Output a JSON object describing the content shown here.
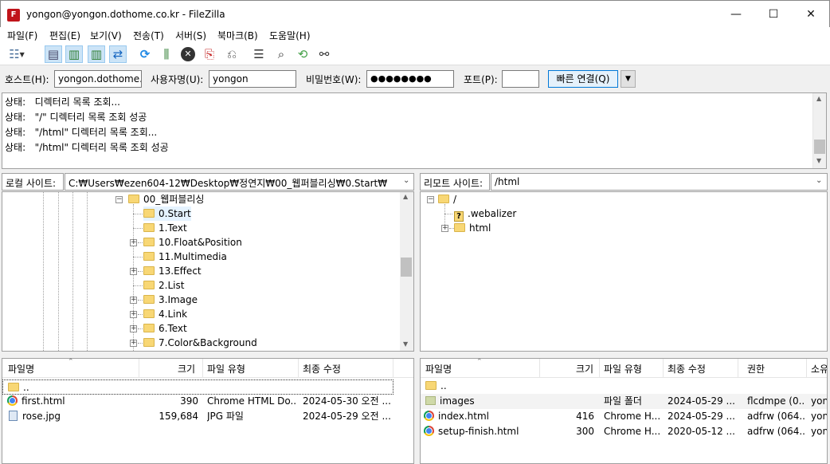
{
  "window": {
    "title": "yongon@yongon.dothome.co.kr - FileZilla",
    "app_icon_letter": "F"
  },
  "menu": [
    "파일(F)",
    "편집(E)",
    "보기(V)",
    "전송(T)",
    "서버(S)",
    "북마크(B)",
    "도움말(H)"
  ],
  "quickconnect": {
    "host_label": "호스트(H):",
    "host_value": "yongon.dothome.c",
    "user_label": "사용자명(U):",
    "user_value": "yongon",
    "pass_label": "비밀번호(W):",
    "pass_value": "●●●●●●●●",
    "port_label": "포트(P):",
    "port_value": "",
    "connect_label": "빠른 연결(Q)"
  },
  "log": [
    {
      "status": "상태:",
      "message": "디렉터리 목록 조회..."
    },
    {
      "status": "상태:",
      "message": "\"/\" 디렉터리 목록 조회 성공"
    },
    {
      "status": "상태:",
      "message": "\"/html\" 디렉터리 목록 조회..."
    },
    {
      "status": "상태:",
      "message": "\"/html\" 디렉터리 목록 조회 성공"
    }
  ],
  "local": {
    "site_label": "로컬 사이트:",
    "path": "C:₩Users₩ezen604-12₩Desktop₩정연지₩00_웹퍼블리싱₩0.Start₩",
    "tree": [
      "00_웹퍼블리싱",
      "0.Start",
      "1.Text",
      "10.Float&Position",
      "11.Multimedia",
      "13.Effect",
      "2.List",
      "3.Image",
      "4.Link",
      "6.Text",
      "7.Color&Background"
    ],
    "columns": [
      "파일명",
      "크기",
      "파일 유형",
      "최종 수정"
    ],
    "files": [
      {
        "name": "..",
        "size": "",
        "type": "",
        "modified": "",
        "icon": "folder-icon"
      },
      {
        "name": "first.html",
        "size": "390",
        "type": "Chrome HTML Do...",
        "modified": "2024-05-30 오전 ...",
        "icon": "chrome-icon"
      },
      {
        "name": "rose.jpg",
        "size": "159,684",
        "type": "JPG 파일",
        "modified": "2024-05-29 오전 ...",
        "icon": "image-file-icon"
      }
    ]
  },
  "remote": {
    "site_label": "리모트 사이트:",
    "path": "/html",
    "tree": [
      "/",
      ".webalizer",
      "html"
    ],
    "columns": [
      "파일명",
      "크기",
      "파일 유형",
      "최종 수정",
      "권한",
      "소유"
    ],
    "files": [
      {
        "name": "..",
        "size": "",
        "type": "",
        "modified": "",
        "perm": "",
        "owner": "",
        "icon": "folder-icon"
      },
      {
        "name": "images",
        "size": "",
        "type": "파일 폴더",
        "modified": "2024-05-29 ...",
        "perm": "flcdmpe (0...",
        "owner": "yon",
        "icon": "folder-icon"
      },
      {
        "name": "index.html",
        "size": "416",
        "type": "Chrome H...",
        "modified": "2024-05-29 ...",
        "perm": "adfrw (064...",
        "owner": "yon",
        "icon": "chrome-icon"
      },
      {
        "name": "setup-finish.html",
        "size": "300",
        "type": "Chrome H...",
        "modified": "2020-05-12 ...",
        "perm": "adfrw (064...",
        "owner": "yon",
        "icon": "chrome-icon"
      }
    ]
  },
  "colors": {
    "accent": "#0078d7",
    "selection": "#cce8ff",
    "folder": "#f8d775"
  }
}
